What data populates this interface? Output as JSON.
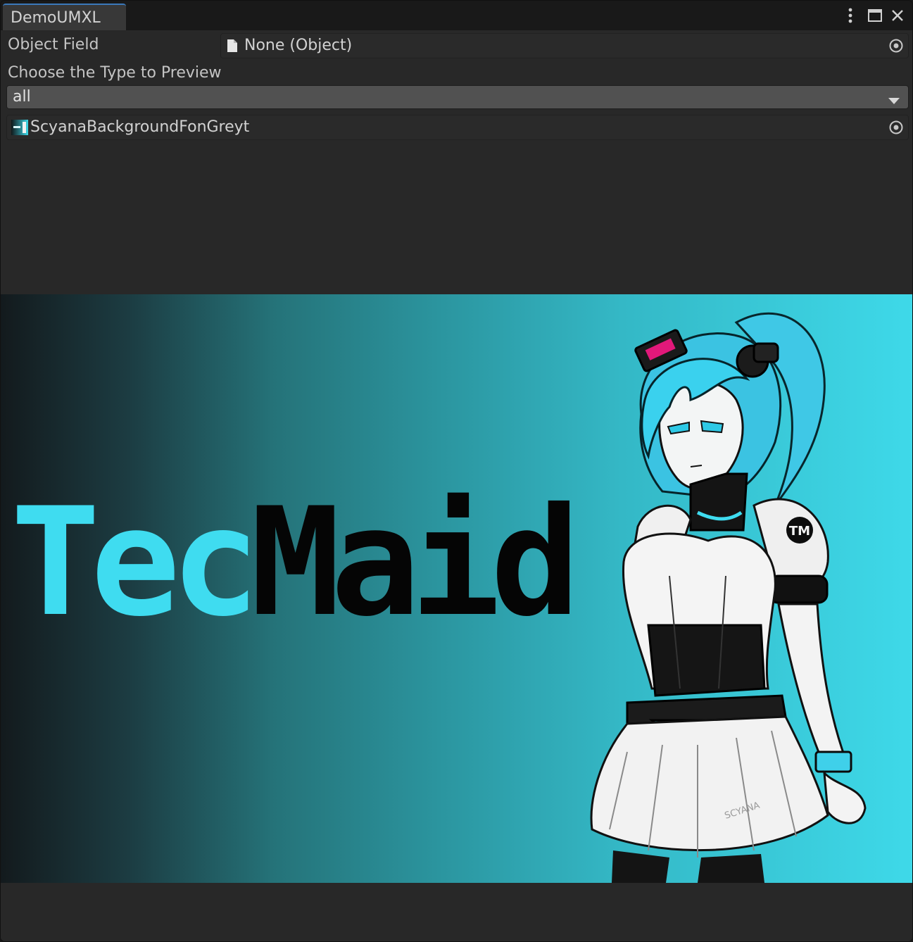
{
  "window": {
    "tab_title": "DemoUMXL",
    "controls": [
      "more-vert-icon",
      "maximize-icon",
      "close-icon"
    ]
  },
  "object_field": {
    "label": "Object Field",
    "value": "None (Object)",
    "icon": "document-icon"
  },
  "type_chooser": {
    "label": "Choose the Type to Preview",
    "selected": "all"
  },
  "asset_field": {
    "value": "ScyanaBackgroundFonGreyt",
    "icon": "texture-thumbnail-icon"
  },
  "preview": {
    "logo_part1": "Tec",
    "logo_part2": "Maid",
    "badge": "TM",
    "signature": "SCYANA",
    "colors": {
      "accent_cyan": "#3fdcf0",
      "logo_dark": "#050505",
      "gradient_dark": "#131a1d",
      "gradient_light": "#3ed9e9"
    }
  },
  "theme": {
    "tab_accent": "#3a79bb",
    "panel_bg": "#282828",
    "field_bg": "#2a2a2a",
    "dropdown_bg": "#515151"
  }
}
